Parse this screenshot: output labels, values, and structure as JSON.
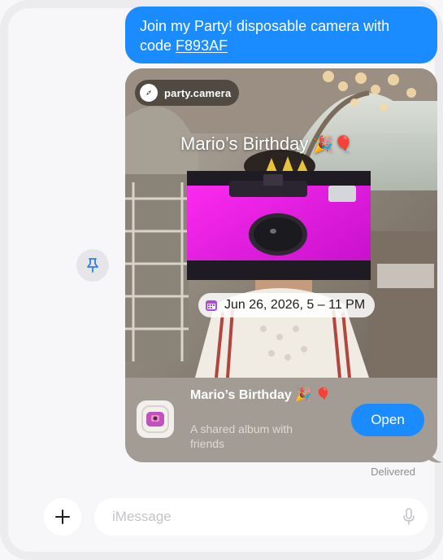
{
  "message": {
    "text_main": "Join my Party! disposable camera with",
    "text_prefix": "code ",
    "code": "F893AF"
  },
  "card": {
    "site": "party.camera",
    "event_title": "Mario’s Birthday",
    "event_emoji": "🎉🎈",
    "date": "Jun 26, 2026, 5 – 11 PM",
    "footer": {
      "title": "Mario’s Birthday 🎉 🎈",
      "subtitle": "A shared album with friends",
      "open_label": "Open"
    }
  },
  "status": "Delivered",
  "composer": {
    "placeholder": "iMessage"
  },
  "icons": {
    "pin": "pin-icon",
    "plus": "plus-icon",
    "mic": "microphone-icon",
    "compass": "compass-icon",
    "calendar": "calendar-icon",
    "app": "party-camera-app-icon"
  },
  "colors": {
    "accent_blue": "#1a8cff",
    "camera_magenta": "#e11ee6"
  }
}
